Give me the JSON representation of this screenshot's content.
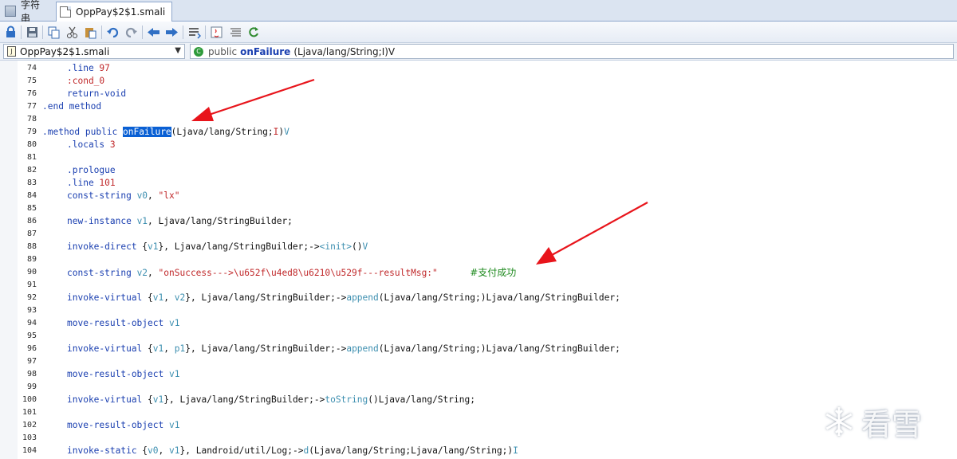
{
  "tabs": [
    {
      "label": "字符串",
      "icon": "strings-icon",
      "active": false
    },
    {
      "label": "OppPay$2$1.smali",
      "icon": "file-icon",
      "active": true
    }
  ],
  "toolbar": {
    "buttons": [
      "lock-icon",
      "save-icon",
      "copy-icon",
      "cut-icon",
      "paste-icon",
      "undo-icon",
      "redo-icon",
      "back-icon",
      "forward-icon",
      "outline-icon",
      "java-icon",
      "format-icon",
      "refresh-icon"
    ]
  },
  "selectors": {
    "file": "OppPay$2$1.smali",
    "method_keyword": "public",
    "method_name": "onFailure",
    "method_signature": "(Ljava/lang/String;I)V"
  },
  "code_lines": [
    {
      "n": "74",
      "indent": true,
      "parts": [
        [
          "dir",
          ".line "
        ],
        [
          "num",
          "97"
        ]
      ]
    },
    {
      "n": "75",
      "indent": true,
      "parts": [
        [
          "label",
          ":cond_0"
        ]
      ]
    },
    {
      "n": "76",
      "indent": true,
      "parts": [
        [
          "inst",
          "return-void"
        ]
      ]
    },
    {
      "n": "77",
      "indent": false,
      "parts": [
        [
          "dir",
          ".end method"
        ]
      ]
    },
    {
      "n": "78",
      "indent": false,
      "parts": []
    },
    {
      "n": "79",
      "indent": false,
      "parts": [
        [
          "dir",
          ".method public "
        ],
        [
          "sel",
          "onFailure"
        ],
        [
          "type",
          "(Ljava/lang/String;"
        ],
        [
          "num",
          "I"
        ],
        [
          "type",
          ")"
        ],
        [
          "reg",
          "V"
        ]
      ]
    },
    {
      "n": "80",
      "indent": true,
      "parts": [
        [
          "dir",
          ".locals "
        ],
        [
          "num",
          "3"
        ]
      ]
    },
    {
      "n": "81",
      "indent": false,
      "parts": []
    },
    {
      "n": "82",
      "indent": true,
      "parts": [
        [
          "dir",
          ".prologue"
        ]
      ]
    },
    {
      "n": "83",
      "indent": true,
      "parts": [
        [
          "dir",
          ".line "
        ],
        [
          "num",
          "101"
        ]
      ]
    },
    {
      "n": "84",
      "indent": true,
      "parts": [
        [
          "inst",
          "const-string "
        ],
        [
          "reg",
          "v0"
        ],
        [
          "punct",
          ", "
        ],
        [
          "str",
          "\"lx\""
        ]
      ]
    },
    {
      "n": "85",
      "indent": false,
      "parts": []
    },
    {
      "n": "86",
      "indent": true,
      "parts": [
        [
          "inst",
          "new-instance "
        ],
        [
          "reg",
          "v1"
        ],
        [
          "punct",
          ", "
        ],
        [
          "type",
          "Ljava/lang/StringBuilder;"
        ]
      ]
    },
    {
      "n": "87",
      "indent": false,
      "parts": []
    },
    {
      "n": "88",
      "indent": true,
      "parts": [
        [
          "inst",
          "invoke-direct "
        ],
        [
          "punct",
          "{"
        ],
        [
          "reg",
          "v1"
        ],
        [
          "punct",
          "}, "
        ],
        [
          "type",
          "Ljava/lang/StringBuilder;->"
        ],
        [
          "call",
          "<init>"
        ],
        [
          "type",
          "()"
        ],
        [
          "reg",
          "V"
        ]
      ]
    },
    {
      "n": "89",
      "indent": false,
      "parts": []
    },
    {
      "n": "90",
      "indent": true,
      "parts": [
        [
          "inst",
          "const-string "
        ],
        [
          "reg",
          "v2"
        ],
        [
          "punct",
          ", "
        ],
        [
          "str",
          "\"onSuccess--->\\u652f\\u4ed8\\u6210\\u529f---resultMsg:\""
        ]
      ],
      "comment": "#支付成功"
    },
    {
      "n": "91",
      "indent": false,
      "parts": []
    },
    {
      "n": "92",
      "indent": true,
      "parts": [
        [
          "inst",
          "invoke-virtual "
        ],
        [
          "punct",
          "{"
        ],
        [
          "reg",
          "v1"
        ],
        [
          "punct",
          ", "
        ],
        [
          "reg",
          "v2"
        ],
        [
          "punct",
          "}, "
        ],
        [
          "type",
          "Ljava/lang/StringBuilder;->"
        ],
        [
          "call",
          "append"
        ],
        [
          "type",
          "(Ljava/lang/String;)Ljava/lang/StringBuilder;"
        ]
      ]
    },
    {
      "n": "93",
      "indent": false,
      "parts": []
    },
    {
      "n": "94",
      "indent": true,
      "parts": [
        [
          "inst",
          "move-result-object "
        ],
        [
          "reg",
          "v1"
        ]
      ]
    },
    {
      "n": "95",
      "indent": false,
      "parts": []
    },
    {
      "n": "96",
      "indent": true,
      "parts": [
        [
          "inst",
          "invoke-virtual "
        ],
        [
          "punct",
          "{"
        ],
        [
          "reg",
          "v1"
        ],
        [
          "punct",
          ", "
        ],
        [
          "reg",
          "p1"
        ],
        [
          "punct",
          "}, "
        ],
        [
          "type",
          "Ljava/lang/StringBuilder;->"
        ],
        [
          "call",
          "append"
        ],
        [
          "type",
          "(Ljava/lang/String;)Ljava/lang/StringBuilder;"
        ]
      ]
    },
    {
      "n": "97",
      "indent": false,
      "parts": []
    },
    {
      "n": "98",
      "indent": true,
      "parts": [
        [
          "inst",
          "move-result-object "
        ],
        [
          "reg",
          "v1"
        ]
      ]
    },
    {
      "n": "99",
      "indent": false,
      "parts": []
    },
    {
      "n": "100",
      "indent": true,
      "parts": [
        [
          "inst",
          "invoke-virtual "
        ],
        [
          "punct",
          "{"
        ],
        [
          "reg",
          "v1"
        ],
        [
          "punct",
          "}, "
        ],
        [
          "type",
          "Ljava/lang/StringBuilder;->"
        ],
        [
          "call",
          "toString"
        ],
        [
          "type",
          "()Ljava/lang/String;"
        ]
      ]
    },
    {
      "n": "101",
      "indent": false,
      "parts": []
    },
    {
      "n": "102",
      "indent": true,
      "parts": [
        [
          "inst",
          "move-result-object "
        ],
        [
          "reg",
          "v1"
        ]
      ]
    },
    {
      "n": "103",
      "indent": false,
      "parts": []
    },
    {
      "n": "104",
      "indent": true,
      "parts": [
        [
          "inst",
          "invoke-static "
        ],
        [
          "punct",
          "{"
        ],
        [
          "reg",
          "v0"
        ],
        [
          "punct",
          ", "
        ],
        [
          "reg",
          "v1"
        ],
        [
          "punct",
          "}, "
        ],
        [
          "type",
          "Landroid/util/Log;->"
        ],
        [
          "call",
          "d"
        ],
        [
          "type",
          "(Ljava/lang/String;Ljava/lang/String;)"
        ],
        [
          "reg",
          "I"
        ]
      ]
    }
  ],
  "watermark": {
    "text": "看雪",
    "icon": "snowflake-icon"
  },
  "colors": {
    "selection": "#0a60d4",
    "arrow": "#e8141b",
    "comment": "#1e8a1e",
    "string": "#c0282a",
    "directive": "#1a3fb0"
  }
}
